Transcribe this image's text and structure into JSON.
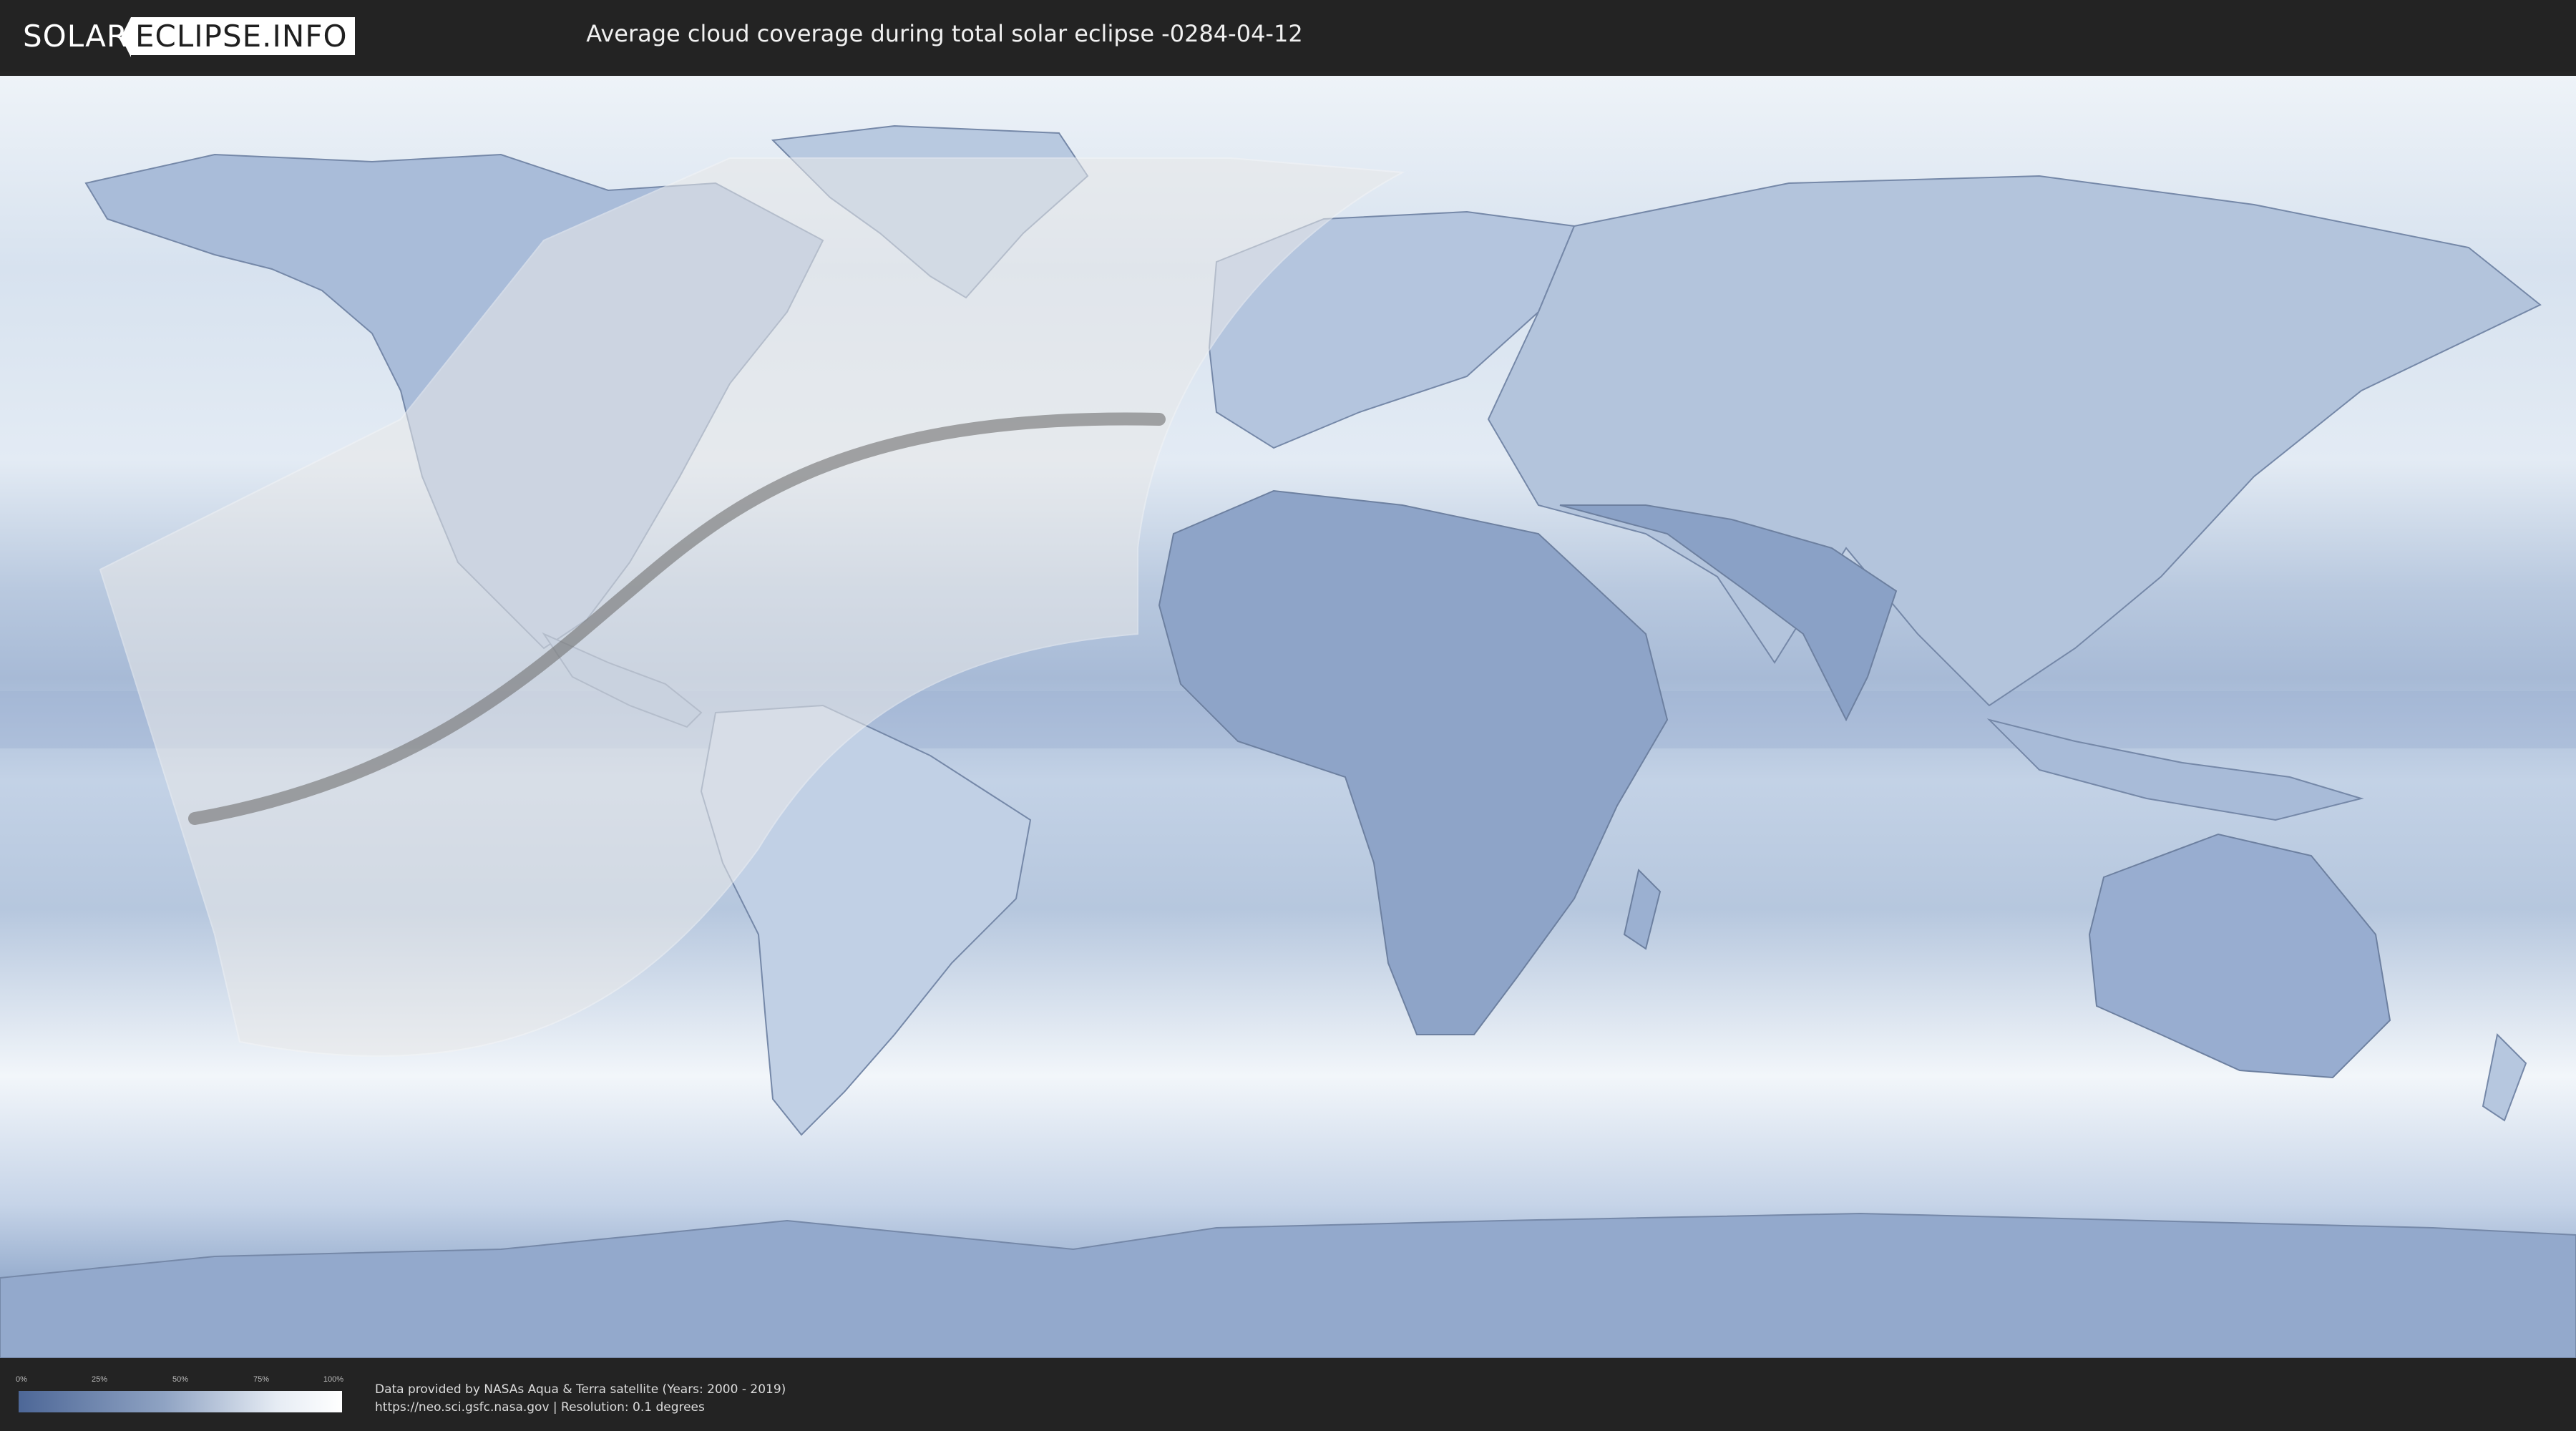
{
  "header": {
    "logo_part1": "SOLAR",
    "logo_part2": "ECLIPSE.INFO",
    "title": "Average cloud coverage during total solar eclipse -0284-04-12"
  },
  "legend": {
    "ticks": [
      "0%",
      "25%",
      "50%",
      "75%",
      "100%"
    ],
    "colors": {
      "clear": "#4d6797",
      "cloudy": "#ffffff"
    }
  },
  "credits": {
    "line1": "Data provided by NASAs Aqua & Terra satellite (Years: 2000 - 2019)",
    "line2": "https://neo.sci.gsfc.nasa.gov | Resolution: 0.1 degrees"
  },
  "map": {
    "projection": "equirectangular",
    "colors": {
      "ocean_cloudy": "#dfe8f2",
      "land_clear": "#7f96bd",
      "penumbra_overlay": "#e9e9e9",
      "totality_path": "#6f6f6f"
    }
  }
}
